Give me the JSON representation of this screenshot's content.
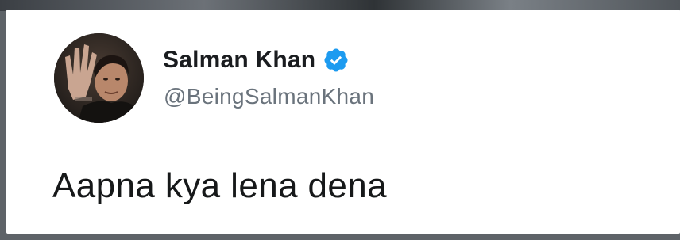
{
  "tweet": {
    "author": {
      "display_name": "Salman Khan",
      "handle": "@BeingSalmanKhan",
      "verified": true,
      "verified_badge_icon": "verified-badge-icon",
      "avatar_icon": "profile-photo"
    },
    "text": "Aapna kya lena dena"
  },
  "colors": {
    "card_background": "#ffffff",
    "name_text": "#1a1c1f",
    "handle_text": "#6a737c",
    "verified_blue": "#1d9bf0",
    "body_text": "#161819"
  }
}
